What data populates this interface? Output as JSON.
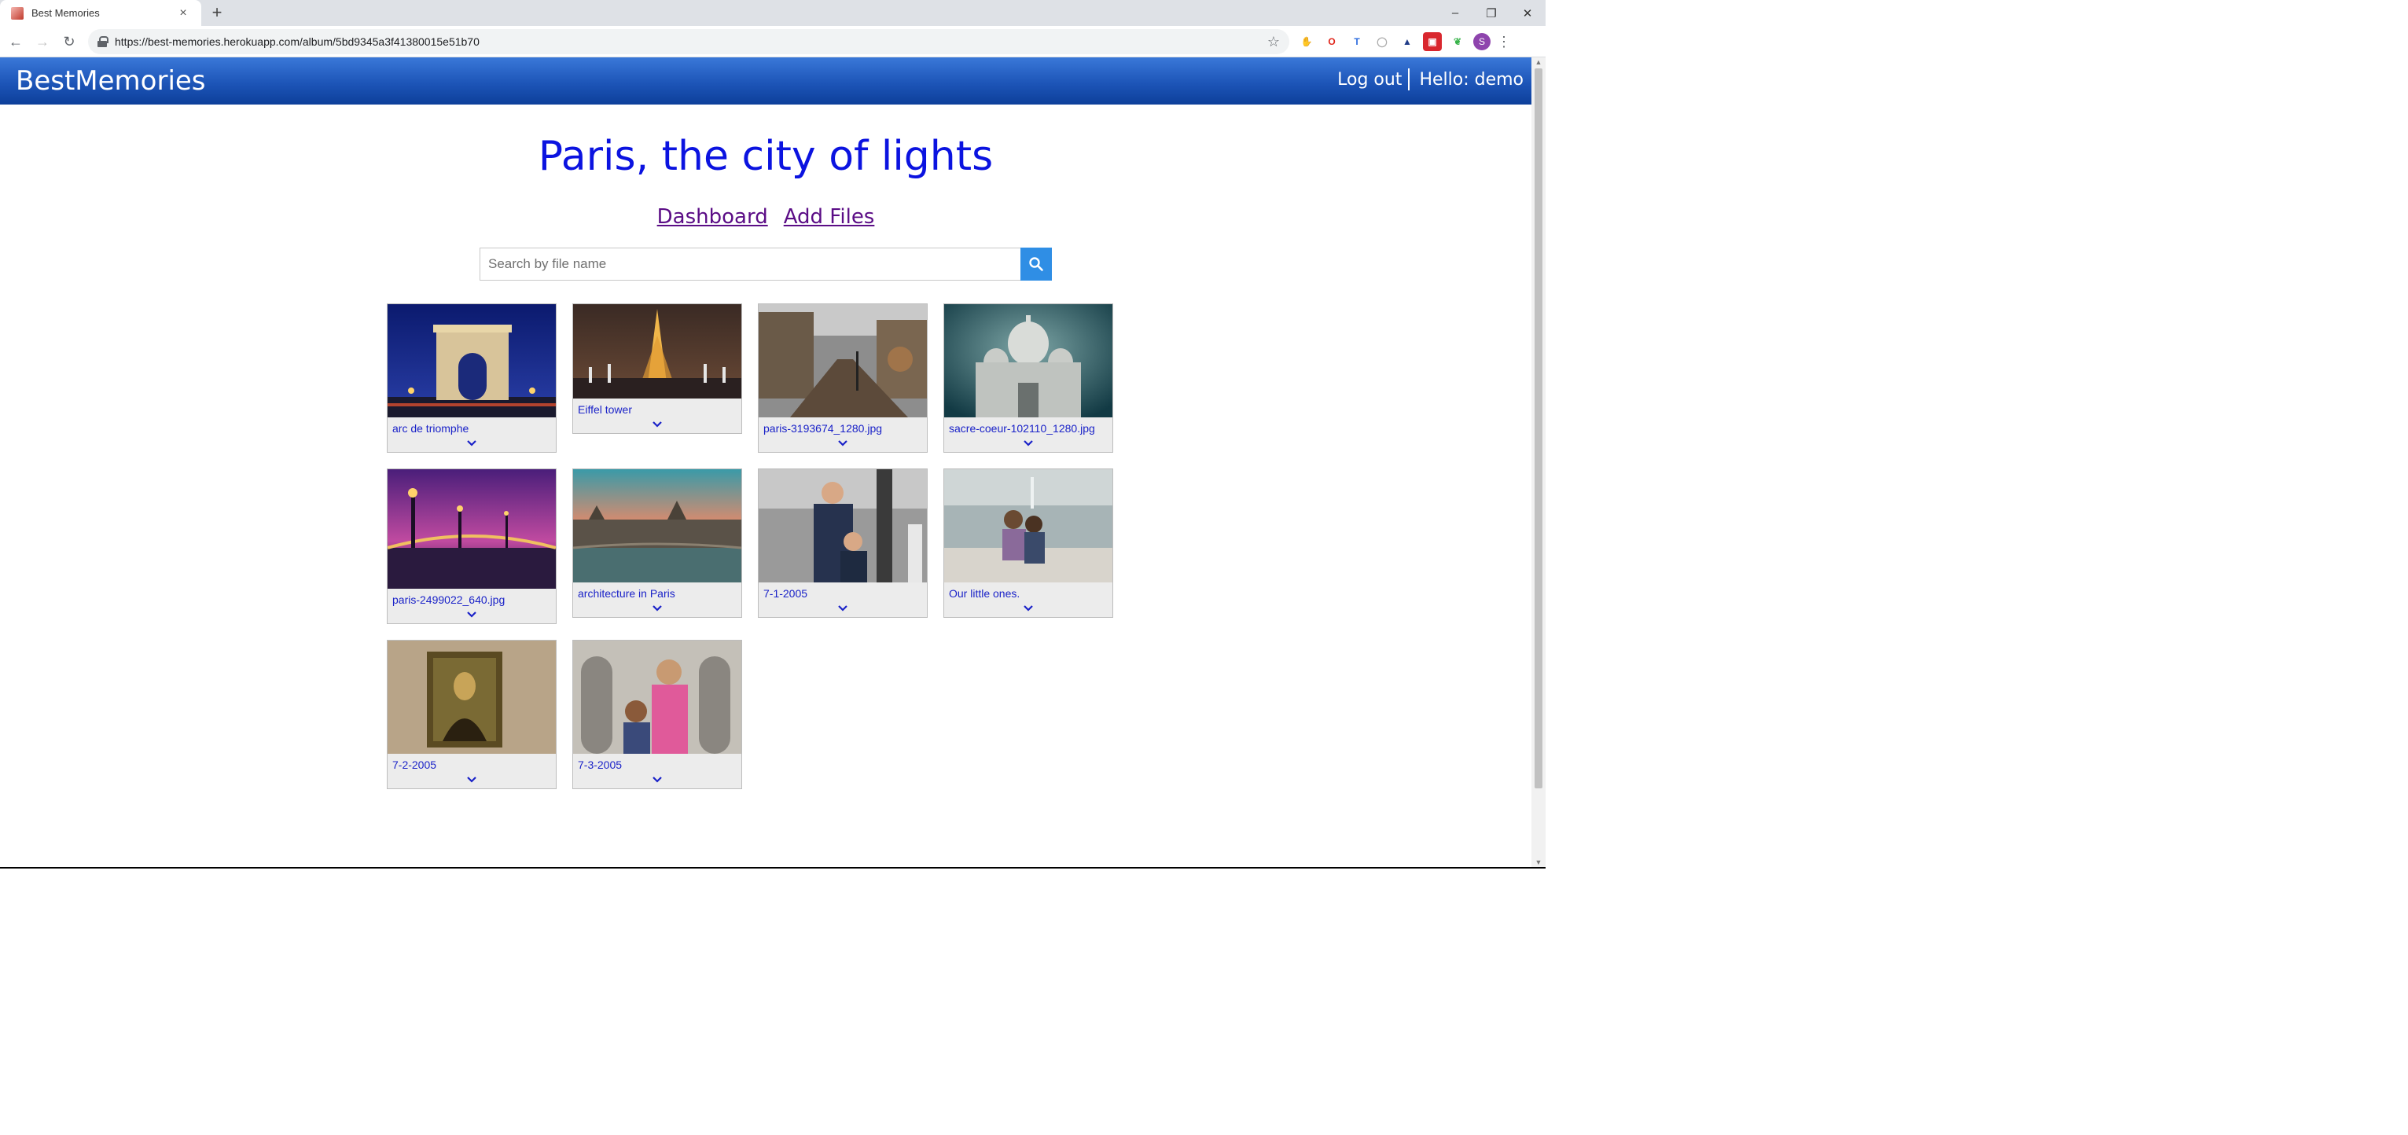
{
  "browser": {
    "tab_title": "Best Memories",
    "tab_close": "×",
    "new_tab": "+",
    "url": "https://best-memories.herokuapp.com/album/5bd9345a3f41380015e51b70",
    "window_controls": {
      "minimize": "–",
      "restore": "❐",
      "close": "✕"
    },
    "nav": {
      "back": "←",
      "forward": "→",
      "reload": "↻"
    },
    "bookmark_star": "☆",
    "profile_initial": "S",
    "menu": "⋮"
  },
  "header": {
    "brand": "BestMemories",
    "logout": "Log out",
    "greeting": "Hello: demo",
    "colors": {
      "top": "#3a78d8",
      "bottom": "#0d3f9a"
    }
  },
  "album": {
    "title": "Paris, the city of lights",
    "title_color": "#0b13e0",
    "links": {
      "dashboard": "Dashboard",
      "add_files": "Add Files"
    }
  },
  "search": {
    "placeholder": "Search by file name",
    "value": "",
    "button_icon": "search-icon",
    "button_color": "#2f8ee5"
  },
  "photos": [
    {
      "caption": "arc de triomphe",
      "scene": "arc-de-triomphe"
    },
    {
      "caption": "Eiffel tower",
      "scene": "eiffel-tower"
    },
    {
      "caption": "paris-3193674_1280.jpg",
      "scene": "street"
    },
    {
      "caption": "sacre-coeur-102110_1280.jpg",
      "scene": "sacre-coeur"
    },
    {
      "caption": "paris-2499022_640.jpg",
      "scene": "bridge-night"
    },
    {
      "caption": "architecture in Paris",
      "scene": "seine-sunset"
    },
    {
      "caption": "7-1-2005",
      "scene": "people-1"
    },
    {
      "caption": "Our little ones.",
      "scene": "fountain-kids"
    },
    {
      "caption": "7-2-2005",
      "scene": "mona-lisa"
    },
    {
      "caption": "7-3-2005",
      "scene": "kids-arches"
    }
  ]
}
